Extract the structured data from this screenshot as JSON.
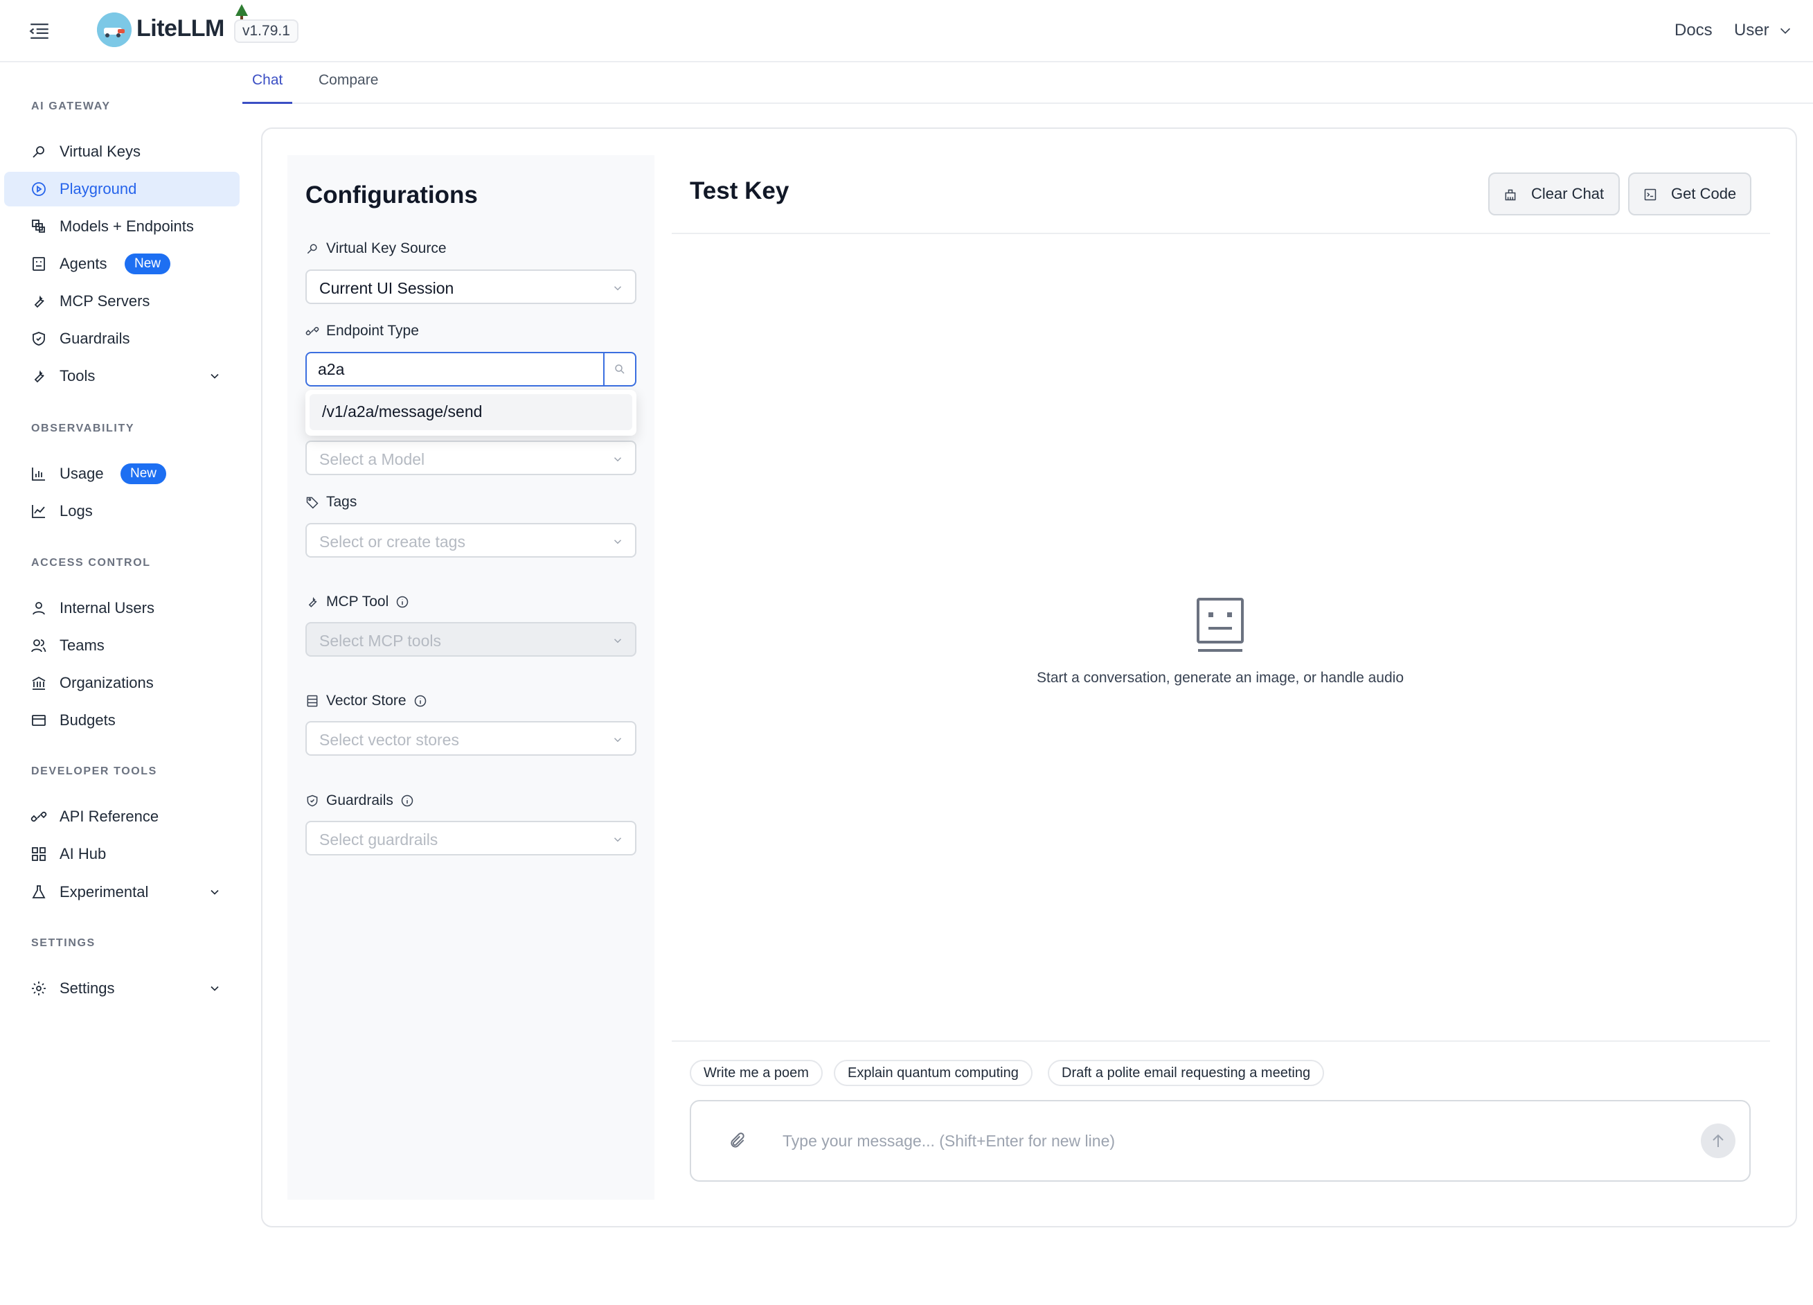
{
  "header": {
    "app_name": "LiteLLM",
    "version": "v1.79.1",
    "docs_label": "Docs",
    "user_label": "User"
  },
  "sidebar": {
    "sections": {
      "ai_gateway": "AI GATEWAY",
      "observability": "OBSERVABILITY",
      "access_control": "ACCESS CONTROL",
      "developer_tools": "DEVELOPER TOOLS",
      "settings": "SETTINGS"
    },
    "items": {
      "virtual_keys": "Virtual Keys",
      "playground": "Playground",
      "models_endpoints": "Models + Endpoints",
      "agents": "Agents",
      "mcp_servers": "MCP Servers",
      "guardrails": "Guardrails",
      "tools": "Tools",
      "usage": "Usage",
      "logs": "Logs",
      "internal_users": "Internal Users",
      "teams": "Teams",
      "organizations": "Organizations",
      "budgets": "Budgets",
      "api_reference": "API Reference",
      "ai_hub": "AI Hub",
      "experimental": "Experimental",
      "settings": "Settings"
    },
    "new_badge": "New",
    "active_item": "Playground"
  },
  "tabs": {
    "chat": "Chat",
    "compare": "Compare",
    "active": "Chat"
  },
  "config": {
    "title": "Configurations",
    "virtual_key_source": {
      "label": "Virtual Key Source",
      "value": "Current UI Session"
    },
    "endpoint_type": {
      "label": "Endpoint Type",
      "search_value": "a2a",
      "option": "/v1/a2a/message/send"
    },
    "model": {
      "placeholder": "Select a Model"
    },
    "tags": {
      "label": "Tags",
      "placeholder": "Select or create tags"
    },
    "mcp_tool": {
      "label": "MCP Tool",
      "placeholder": "Select MCP tools"
    },
    "vector_store": {
      "label": "Vector Store",
      "placeholder": "Select vector stores"
    },
    "guardrails": {
      "label": "Guardrails",
      "placeholder": "Select guardrails"
    }
  },
  "chat": {
    "title": "Test Key",
    "clear_chat": "Clear Chat",
    "get_code": "Get Code",
    "empty_state": "Start a conversation, generate an image, or handle audio",
    "suggestions": [
      "Write me a poem",
      "Explain quantum computing",
      "Draft a polite email requesting a meeting"
    ],
    "input_placeholder": "Type your message... (Shift+Enter for new line)"
  },
  "colors": {
    "accent": "#3b4fc4",
    "active_nav_bg": "#e3edfd",
    "active_nav_text": "#2563eb",
    "badge_bg": "#1d6ff2",
    "focus_border": "#3b6fe0"
  }
}
